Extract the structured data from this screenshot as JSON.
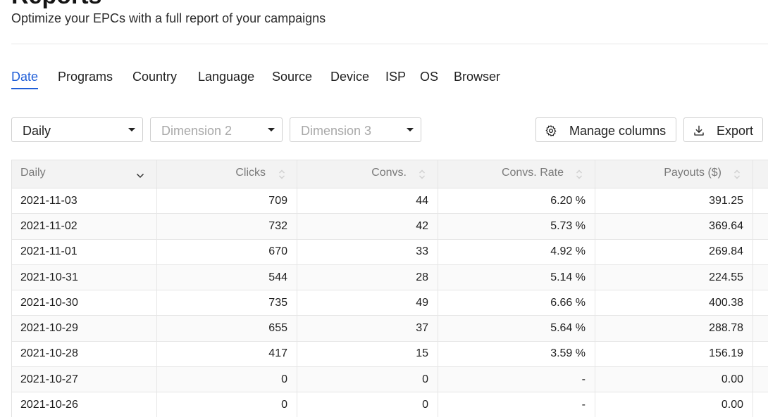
{
  "header": {
    "title": "Reports",
    "subtitle": "Optimize your EPCs with a full report of your campaigns"
  },
  "tabs": [
    {
      "label": "Date",
      "active": true
    },
    {
      "label": "Programs"
    },
    {
      "label": "Country"
    },
    {
      "label": "Language"
    },
    {
      "label": "Source"
    },
    {
      "label": "Device"
    },
    {
      "label": "ISP"
    },
    {
      "label": "OS"
    },
    {
      "label": "Browser"
    }
  ],
  "filters": {
    "dimension1": "Daily",
    "dimension2_placeholder": "Dimension 2",
    "dimension3_placeholder": "Dimension 3"
  },
  "actions": {
    "manage_columns": "Manage columns",
    "export": "Export"
  },
  "table": {
    "columns": [
      "Daily",
      "Clicks",
      "Convs.",
      "Convs. Rate",
      "Payouts ($)"
    ],
    "rows": [
      [
        "2021-11-03",
        "709",
        "44",
        "6.20 %",
        "391.25"
      ],
      [
        "2021-11-02",
        "732",
        "42",
        "5.73 %",
        "369.64"
      ],
      [
        "2021-11-01",
        "670",
        "33",
        "4.92 %",
        "269.84"
      ],
      [
        "2021-10-31",
        "544",
        "28",
        "5.14 %",
        "224.55"
      ],
      [
        "2021-10-30",
        "735",
        "49",
        "6.66 %",
        "400.38"
      ],
      [
        "2021-10-29",
        "655",
        "37",
        "5.64 %",
        "288.78"
      ],
      [
        "2021-10-28",
        "417",
        "15",
        "3.59 %",
        "156.19"
      ],
      [
        "2021-10-27",
        "0",
        "0",
        "-",
        "0.00"
      ],
      [
        "2021-10-26",
        "0",
        "0",
        "-",
        "0.00"
      ]
    ]
  },
  "colors": {
    "accent": "#1f5ed8",
    "header_bg": "#f3f3f3",
    "border": "#e2e2e2"
  },
  "icons": {
    "manage_columns": "gear-icon",
    "export": "download-icon",
    "sort": "sort-icon",
    "dropdown": "chevron-down-icon"
  }
}
